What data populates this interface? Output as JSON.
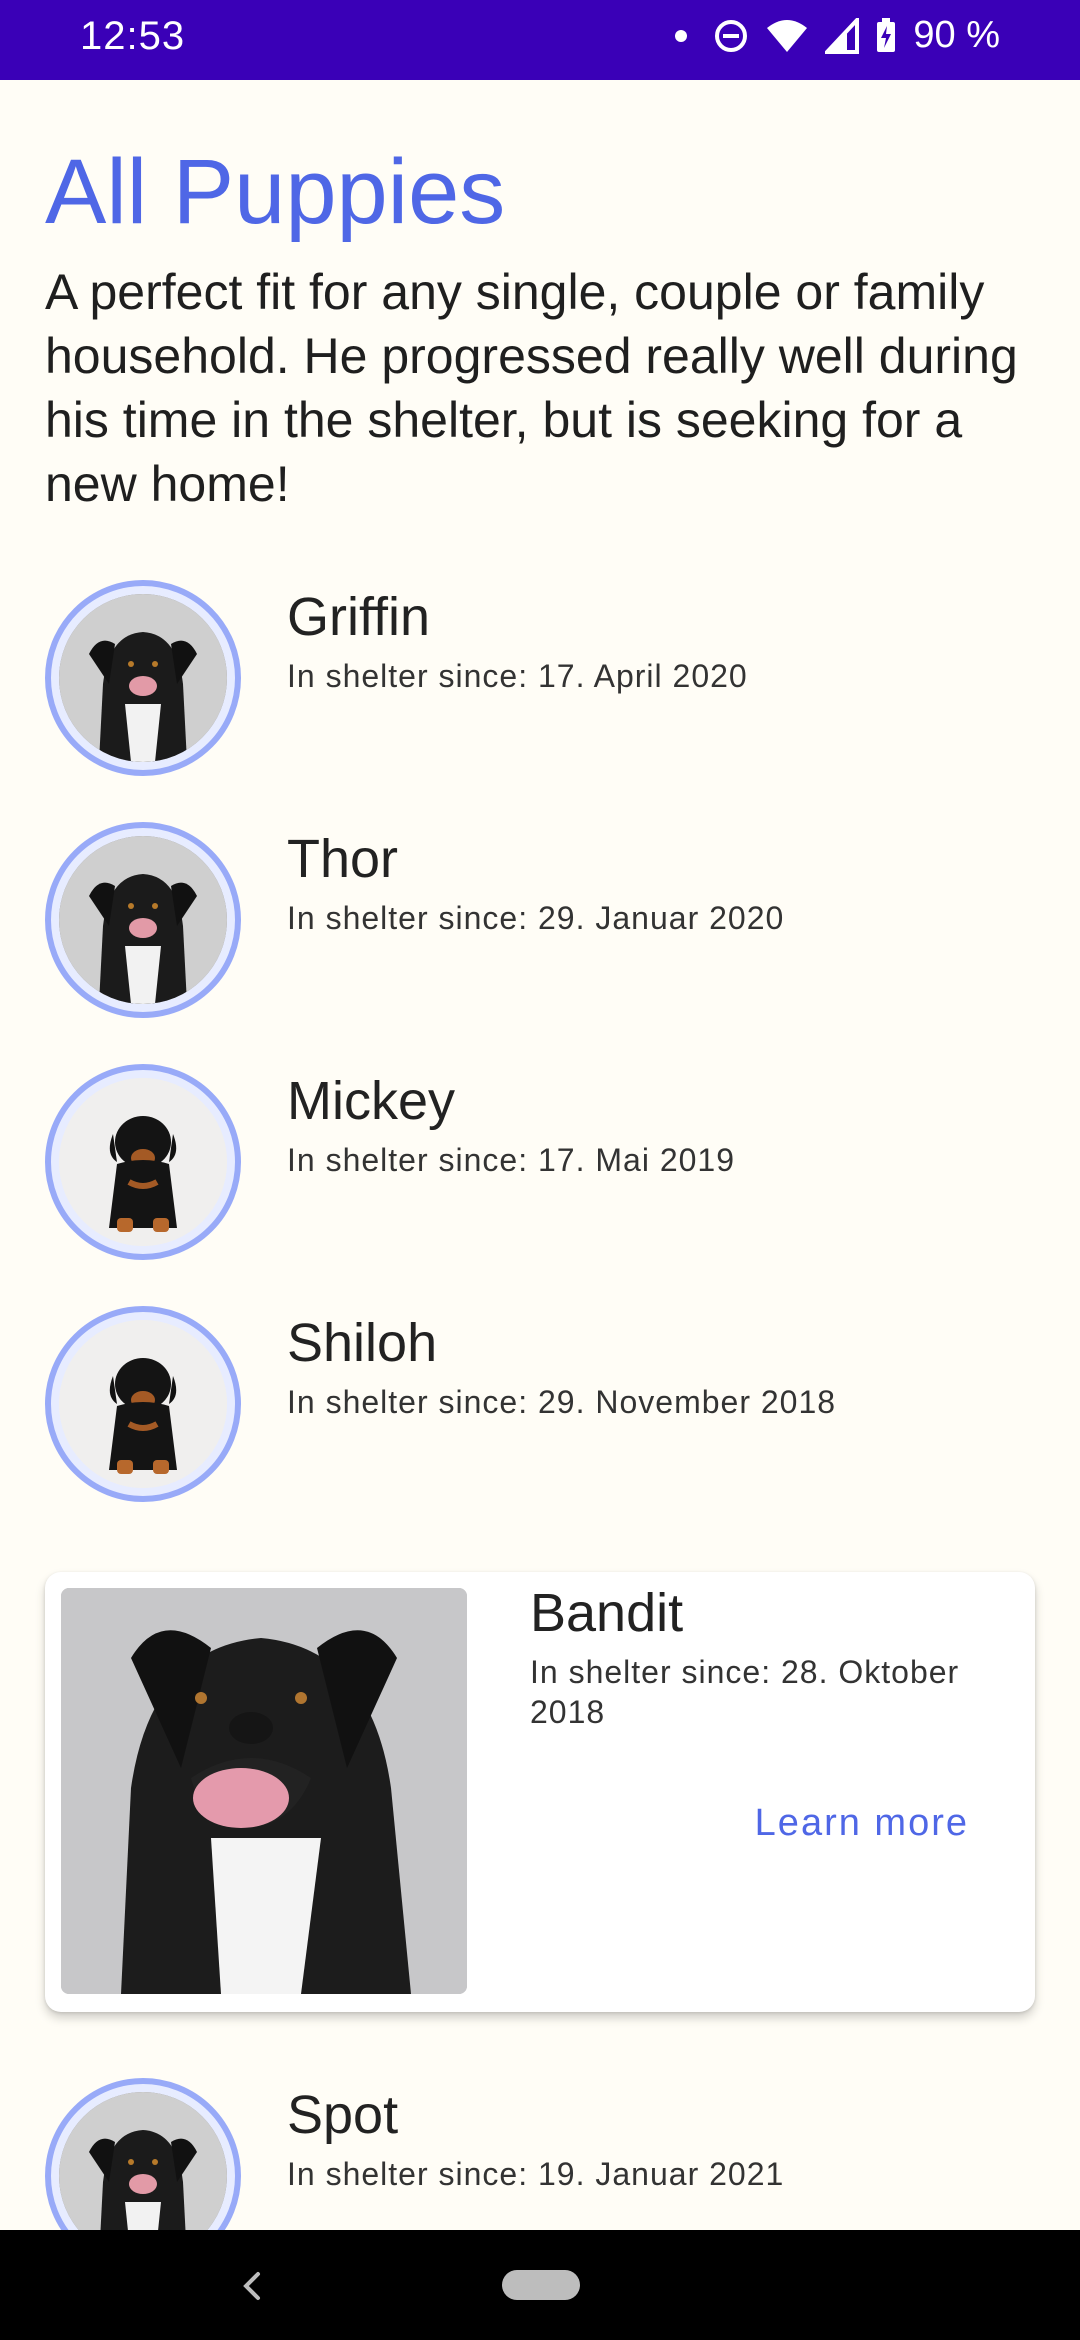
{
  "status_bar": {
    "time": "12:53",
    "battery": "90 %"
  },
  "header": {
    "title": "All Puppies",
    "subtitle": "A perfect fit for any single, couple or family household. He progressed really well during his time in the shelter, but is seeking for a new home!"
  },
  "list": [
    {
      "name": "Griffin",
      "since": "In shelter since: 17. April 2020",
      "icon": "black-dog-avatar"
    },
    {
      "name": "Thor",
      "since": "In shelter since: 29. Januar 2020",
      "icon": "black-dog-avatar"
    },
    {
      "name": "Mickey",
      "since": "In shelter since: 17. Mai 2019",
      "icon": "rottweiler-puppy-avatar"
    },
    {
      "name": "Shiloh",
      "since": "In shelter since: 29. November 2018",
      "icon": "rottweiler-puppy-avatar"
    }
  ],
  "featured": {
    "name": "Bandit",
    "since": "In shelter since: 28. Oktober 2018",
    "learn_more": "Learn more"
  },
  "list2": [
    {
      "name": "Spot",
      "since": "In shelter since: 19. Januar 2021",
      "icon": "black-dog-avatar"
    }
  ],
  "colors": {
    "status_bar": "#3A00B7",
    "accent": "#4F67E6",
    "avatar_ring": "#98AAF8",
    "background": "#FFFDF6"
  }
}
